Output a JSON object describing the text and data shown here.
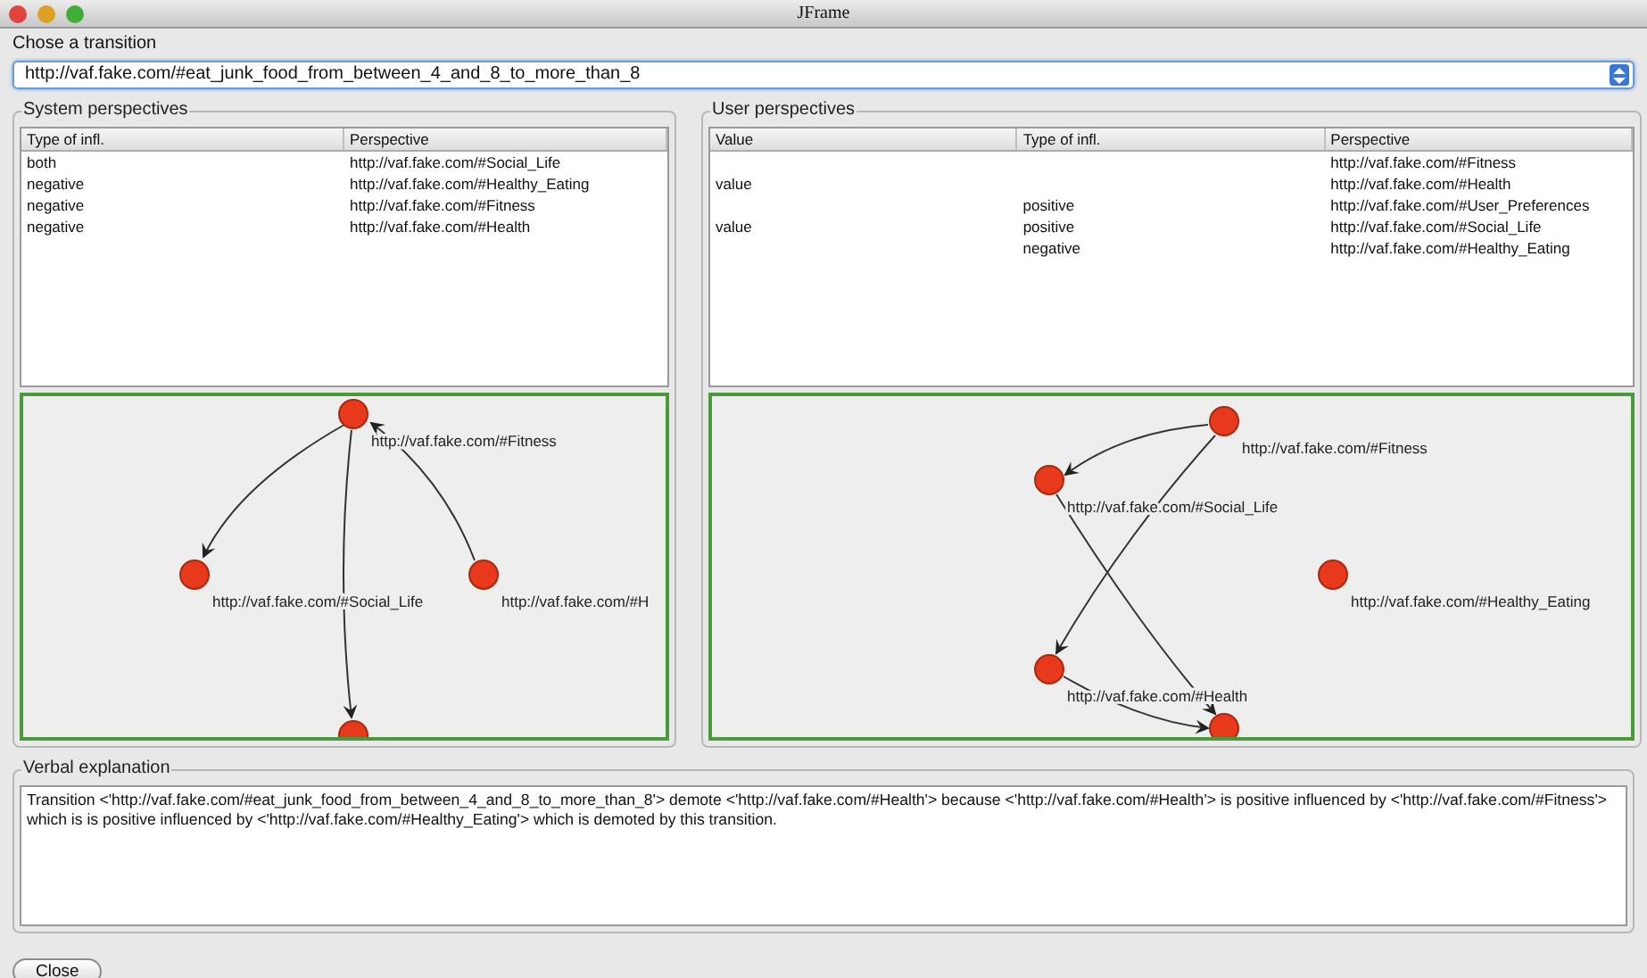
{
  "window": {
    "title": "JFrame"
  },
  "transition": {
    "label": "Chose a transition",
    "value": "http://vaf.fake.com/#eat_junk_food_from_between_4_and_8_to_more_than_8"
  },
  "system_perspectives": {
    "title": "System perspectives",
    "columns": [
      "Type of infl.",
      "Perspective"
    ],
    "rows": [
      [
        "both",
        "http://vaf.fake.com/#Social_Life"
      ],
      [
        "negative",
        "http://vaf.fake.com/#Healthy_Eating"
      ],
      [
        "negative",
        "http://vaf.fake.com/#Fitness"
      ],
      [
        "negative",
        "http://vaf.fake.com/#Health"
      ]
    ],
    "graph": {
      "nodes": [
        {
          "kind": "labeled",
          "label": "http://vaf.fake.com/#Fitness"
        },
        {
          "kind": "labeled",
          "label": "http://vaf.fake.com/#Social_Life"
        },
        {
          "kind": "labeled",
          "label": "http://vaf.fake.com/#H"
        },
        {
          "kind": "plain"
        }
      ]
    }
  },
  "user_perspectives": {
    "title": "User perspectives",
    "columns": [
      "Value",
      "Type of infl.",
      "Perspective"
    ],
    "rows": [
      [
        "",
        "",
        "http://vaf.fake.com/#Fitness"
      ],
      [
        "value",
        "",
        "http://vaf.fake.com/#Health"
      ],
      [
        "",
        "positive",
        "http://vaf.fake.com/#User_Preferences"
      ],
      [
        "value",
        "positive",
        "http://vaf.fake.com/#Social_Life"
      ],
      [
        "",
        "negative",
        "http://vaf.fake.com/#Healthy_Eating"
      ]
    ],
    "graph": {
      "nodes": [
        {
          "kind": "labeled",
          "label": "http://vaf.fake.com/#Fitness"
        },
        {
          "kind": "labeled",
          "label": "http://vaf.fake.com/#Social_Life"
        },
        {
          "kind": "labeled",
          "label": "http://vaf.fake.com/#Healthy_Eating"
        },
        {
          "kind": "labeled",
          "label": "http://vaf.fake.com/#Health"
        },
        {
          "kind": "plain"
        }
      ]
    }
  },
  "verbal_explanation": {
    "title": "Verbal explanation",
    "text": "Transition <'http://vaf.fake.com/#eat_junk_food_from_between_4_and_8_to_more_than_8'> demote <'http://vaf.fake.com/#Health'> because <'http://vaf.fake.com/#Health'>  is positive influenced by <'http://vaf.fake.com/#Fitness'>  which is  is positive influenced by <'http://vaf.fake.com/#Healthy_Eating'>  which is demoted by this transition."
  },
  "buttons": [
    "Close"
  ]
}
